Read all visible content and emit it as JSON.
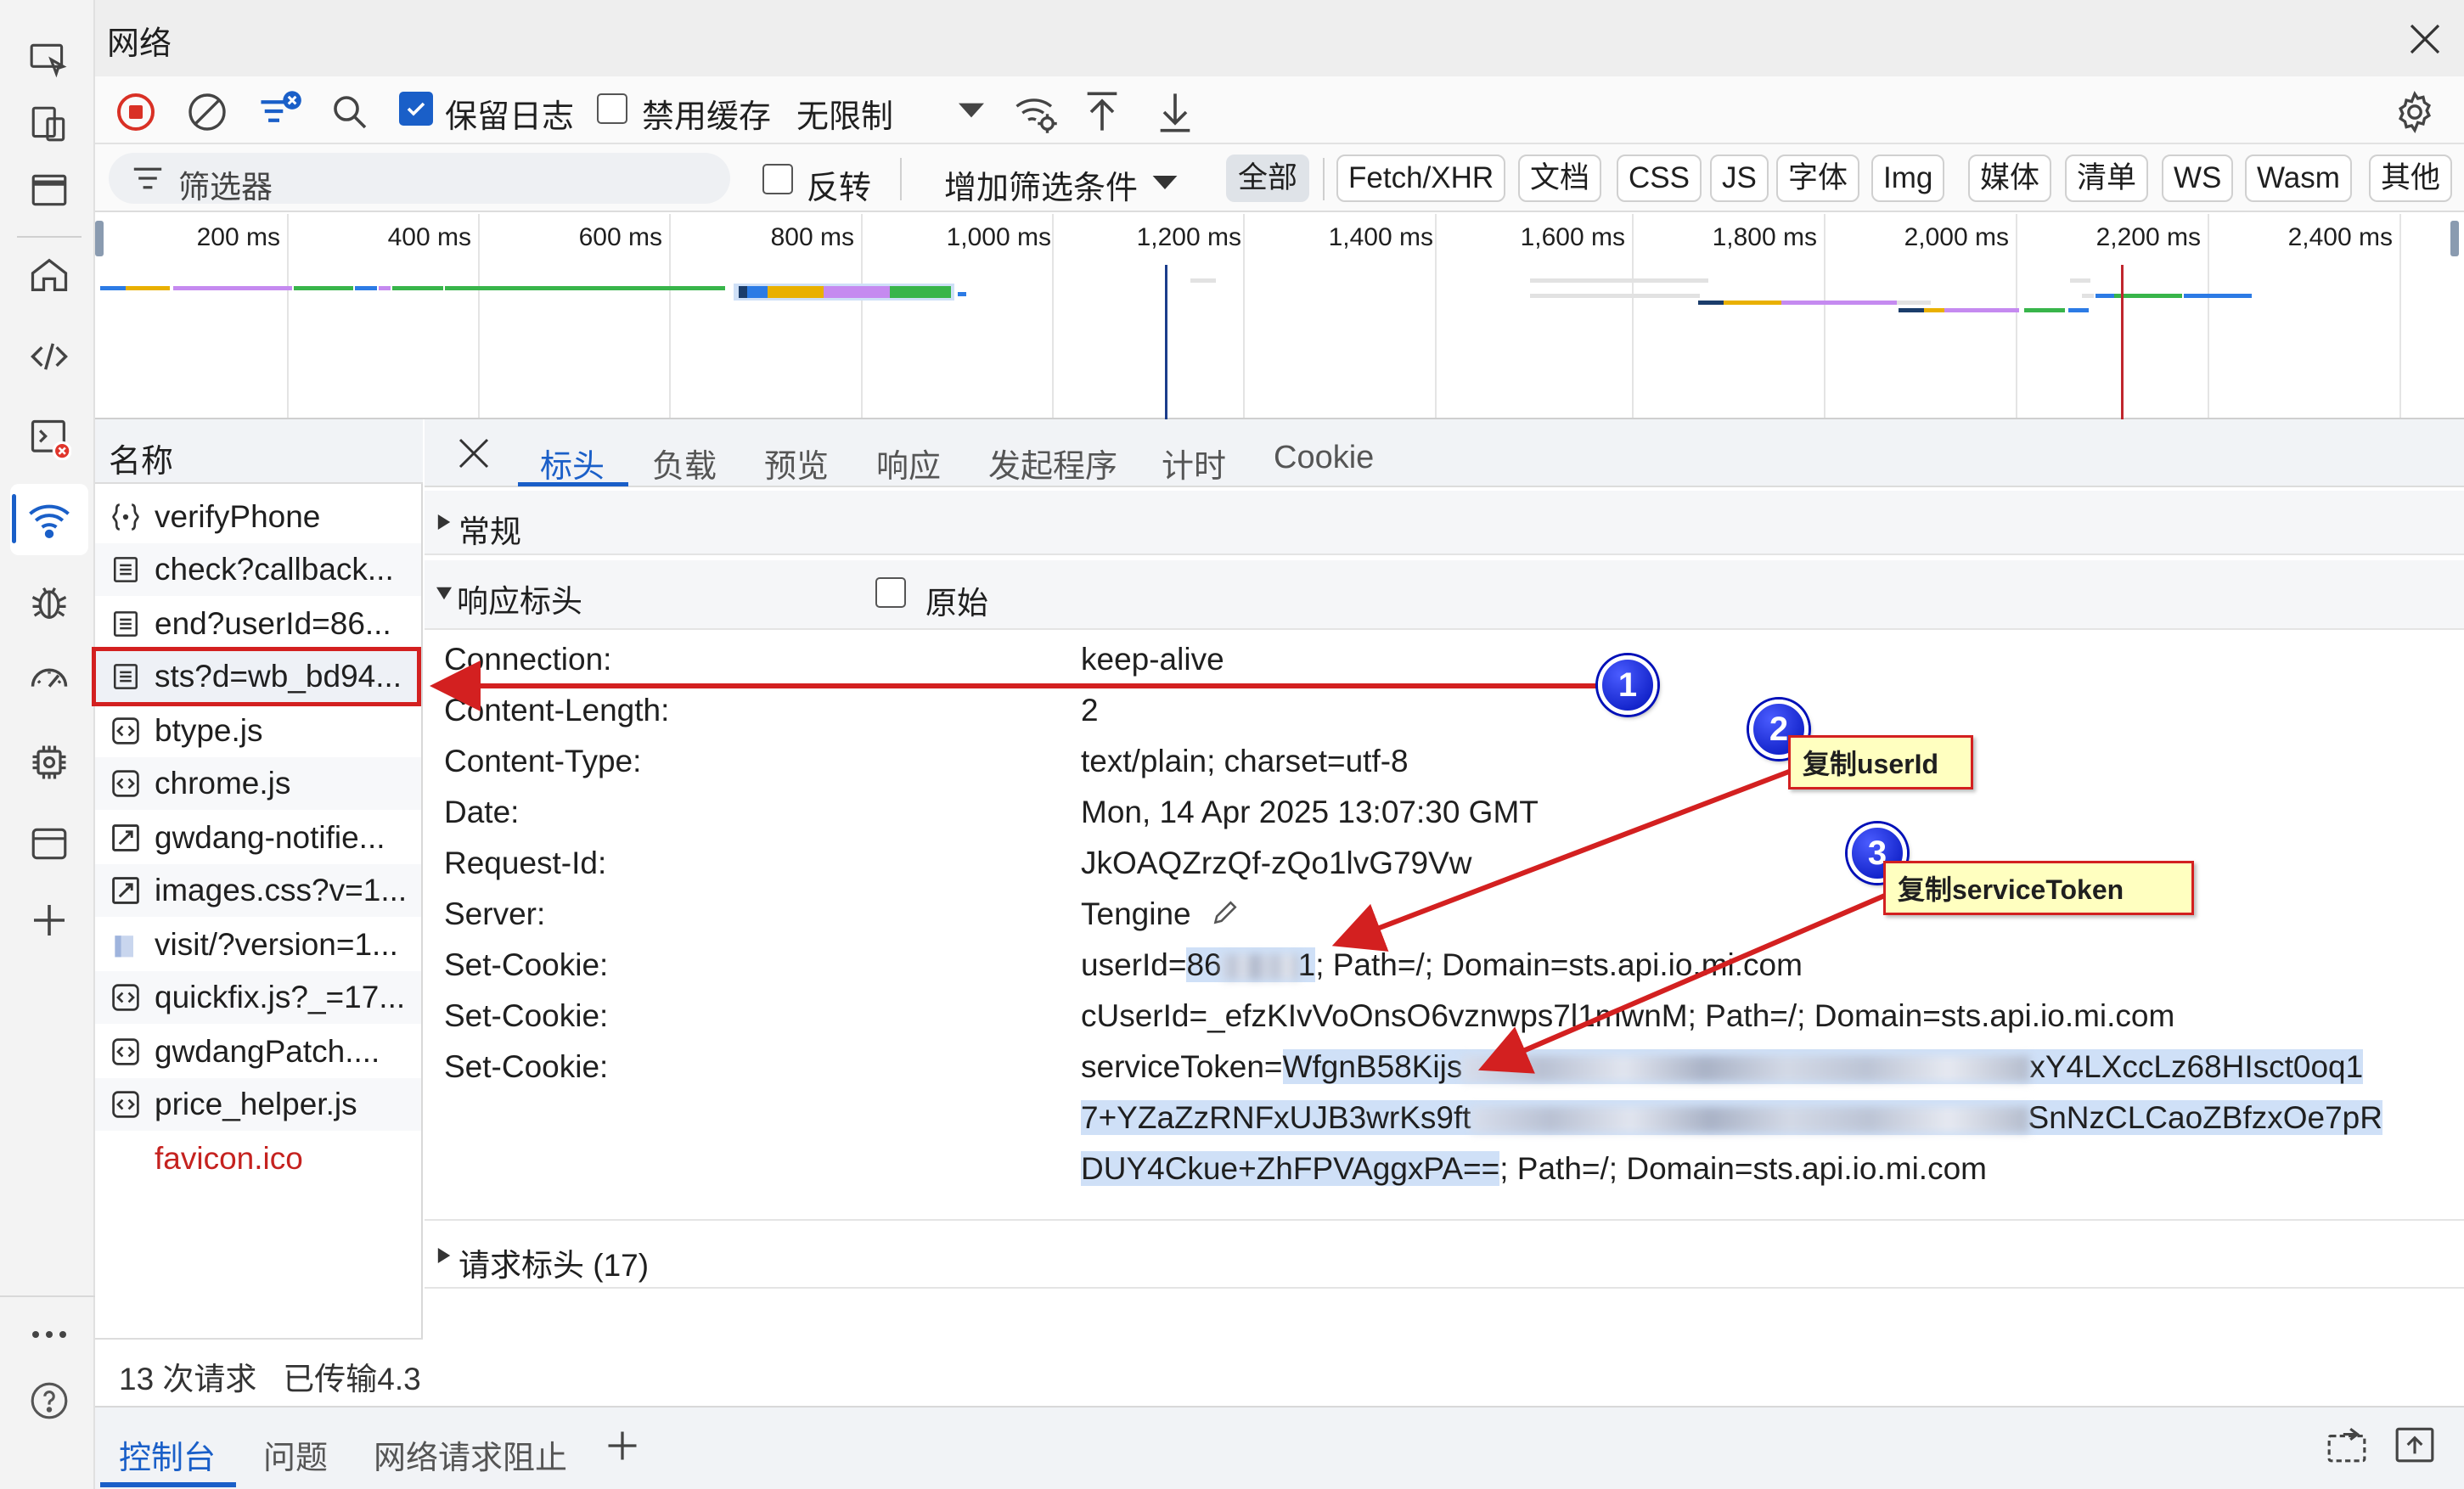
{
  "window": {
    "title": "网络"
  },
  "toolbar": {
    "preserve_log": "保留日志",
    "preserve_log_checked": true,
    "disable_cache": "禁用缓存",
    "disable_cache_checked": false,
    "throttle": "无限制"
  },
  "filterbar": {
    "filter_placeholder": "筛选器",
    "invert": "反转",
    "more_filters": "增加筛选条件",
    "types": [
      "全部",
      "Fetch/XHR",
      "文档",
      "CSS",
      "JS",
      "字体",
      "Img",
      "媒体",
      "清单",
      "WS",
      "Wasm",
      "其他"
    ],
    "active_type": "全部"
  },
  "timeline": {
    "ticks": [
      "200 ms",
      "400 ms",
      "600 ms",
      "800 ms",
      "1,000 ms",
      "1,200 ms",
      "1,400 ms",
      "1,600 ms",
      "1,800 ms",
      "2,000 ms",
      "2,200 ms",
      "2,400 ms"
    ]
  },
  "request_list": {
    "header": "名称",
    "items": [
      {
        "name": "verifyPhone",
        "icon": "xhr-braces-icon"
      },
      {
        "name": "check?callback...",
        "icon": "document-icon"
      },
      {
        "name": "end?userId=86...",
        "icon": "document-icon"
      },
      {
        "name": "sts?d=wb_bd94...",
        "icon": "document-icon",
        "selected": true
      },
      {
        "name": "btype.js",
        "icon": "script-icon"
      },
      {
        "name": "chrome.js",
        "icon": "script-icon"
      },
      {
        "name": "gwdang-notifie...",
        "icon": "stylesheet-icon"
      },
      {
        "name": "images.css?v=1...",
        "icon": "stylesheet-icon"
      },
      {
        "name": "visit/?version=1...",
        "icon": "image-icon"
      },
      {
        "name": "quickfix.js?_=17...",
        "icon": "script-icon"
      },
      {
        "name": "gwdangPatch....",
        "icon": "script-icon"
      },
      {
        "name": "price_helper.js",
        "icon": "script-icon"
      },
      {
        "name": "favicon.ico",
        "icon": "",
        "error": true
      }
    ],
    "status": "13 次请求   已传输4.3"
  },
  "details": {
    "tabs": [
      "标头",
      "负载",
      "预览",
      "响应",
      "发起程序",
      "计时",
      "Cookie"
    ],
    "active_tab": "标头",
    "sections": {
      "general": "常规",
      "response_headers": "响应标头",
      "raw": "原始",
      "request_headers": "请求标头 (17)"
    },
    "headers": [
      {
        "k": "Connection:",
        "v": "keep-alive"
      },
      {
        "k": "Content-Length:",
        "v": "2"
      },
      {
        "k": "Content-Type:",
        "v": "text/plain; charset=utf-8"
      },
      {
        "k": "Date:",
        "v": "Mon, 14 Apr 2025 13:07:30 GMT"
      },
      {
        "k": "Request-Id:",
        "v": "JkOAQZrzQf-zQo1lvG79Vw"
      },
      {
        "k": "Server:",
        "v": "Tengine"
      },
      {
        "k": "Set-Cookie:",
        "v": ""
      },
      {
        "k": "Set-Cookie:",
        "v": "cUserId=_efzKIvVoOnsO6vznwps7l1mwnM; Path=/; Domain=sts.api.io.mi.com"
      },
      {
        "k": "Set-Cookie:",
        "v": ""
      }
    ],
    "userid_cookie": {
      "prefix": "userId=",
      "val_start": "86",
      "val_end": "1",
      "suffix": "; Path=/; Domain=sts.api.io.mi.com"
    },
    "token_cookie": {
      "prefix": "serviceToken=",
      "l1_start": "WfgnB58Kijs",
      "l1_end": "xY4LXccLz68HIsct0oq1",
      "l2_start": "7+YZaZzRNFxUJB3wrKs9ft",
      "l2_end": "SnNzCLCaoZBfzxOe7pR",
      "l3": "DUY4Ckue+ZhFPVAggxPA==",
      "suffix": "; Path=/; Domain=sts.api.io.mi.com"
    }
  },
  "drawer": {
    "tabs": [
      "控制台",
      "问题",
      "网络请求阻止"
    ],
    "active": "控制台"
  },
  "annotations": {
    "badges": [
      "1",
      "2",
      "3"
    ],
    "callout2": "复制userId",
    "callout3": "复制serviceToken",
    "color": "#d32020"
  }
}
